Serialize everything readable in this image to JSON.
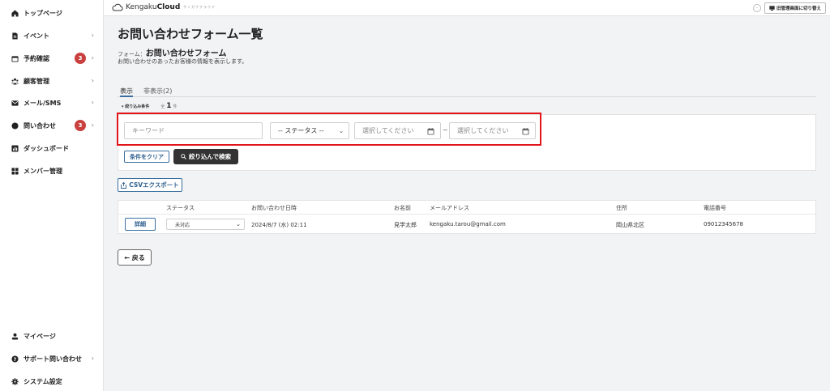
{
  "sidebar": {
    "items": [
      {
        "label": "トップページ",
        "icon": "home-icon"
      },
      {
        "label": "イベント",
        "icon": "document-icon"
      },
      {
        "label": "予約確認",
        "icon": "calendar-icon",
        "badge": "3"
      },
      {
        "label": "顧客管理",
        "icon": "users-icon"
      },
      {
        "label": "メール/SMS",
        "icon": "mail-icon"
      },
      {
        "label": "問い合わせ",
        "icon": "chat-icon",
        "badge": "3"
      },
      {
        "label": "ダッシュボード",
        "icon": "chart-icon"
      },
      {
        "label": "メンバー管理",
        "icon": "grid-icon"
      }
    ],
    "bottom_items": [
      {
        "label": "マイページ",
        "icon": "person-icon"
      },
      {
        "label": "サポート問い合わせ",
        "icon": "help-icon"
      },
      {
        "label": "システム設定",
        "icon": "gear-icon"
      }
    ]
  },
  "topbar": {
    "brand_a": "Kengaku",
    "brand_b": "Cloud",
    "brand_sub": "ケンガククラウド",
    "switch_label": "旧管理画面に切り替え"
  },
  "main": {
    "title": "お問い合わせフォーム一覧",
    "form_prefix": "フォーム：",
    "form_name": "お問い合わせフォーム",
    "description": "お問い合わせのあったお客様の情報を表示します。",
    "tabs": [
      {
        "label": "表示"
      },
      {
        "label": "非表示(2)"
      }
    ],
    "filter": {
      "title": "▾ 絞り込み条件",
      "count_prefix": "全",
      "count": "1",
      "count_suffix": "件",
      "keyword_placeholder": "キーワード",
      "status_selected": "-- ステータス --",
      "date_from_placeholder": "選択してください",
      "date_to_placeholder": "選択してください",
      "separator": "~",
      "clear_label": "条件をクリア",
      "search_label": "絞り込んで検索"
    },
    "csv_label": "CSVエクスポート",
    "table": {
      "headers": [
        "ステータス",
        "お問い合わせ日時",
        "お名前",
        "メールアドレス",
        "住所",
        "電話番号"
      ],
      "rows": [
        {
          "detail_label": "詳細",
          "status": "未対応",
          "datetime": "2024/8/7 (水) 02:11",
          "name": "見学太郎",
          "email": "kengaku.tarou@gmail.com",
          "address": "岡山県北区",
          "phone": "09012345678"
        }
      ]
    },
    "back_label": "← 戻る"
  },
  "colors": {
    "accent": "#3a6fa0",
    "badge": "#c9413f",
    "highlight": "#e0161b",
    "dark_button": "#333333"
  }
}
